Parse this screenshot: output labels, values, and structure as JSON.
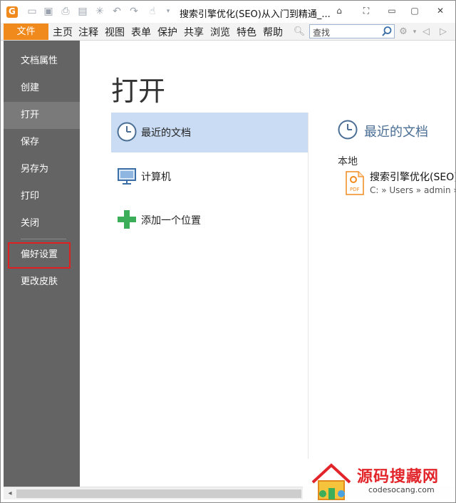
{
  "titlebar": {
    "document_title": "搜索引擎优化(SEO)从入门到精通_..."
  },
  "menubar": {
    "file_tab": "文件",
    "items": [
      "主页",
      "注释",
      "视图",
      "表单",
      "保护",
      "共享",
      "浏览",
      "特色",
      "帮助"
    ],
    "search_placeholder": "查找"
  },
  "leftnav": {
    "items": [
      {
        "label": "文档属性"
      },
      {
        "label": "创建"
      },
      {
        "label": "打开"
      },
      {
        "label": "保存"
      },
      {
        "label": "另存为"
      },
      {
        "label": "打印"
      },
      {
        "label": "关闭"
      },
      {
        "label": "偏好设置"
      },
      {
        "label": "更改皮肤"
      }
    ],
    "active_item": "打开",
    "highlighted_item": "偏好设置"
  },
  "main": {
    "title": "打开",
    "options": [
      {
        "label": "最近的文档",
        "icon": "clock-icon"
      },
      {
        "label": "计算机",
        "icon": "computer-icon"
      },
      {
        "label": "添加一个位置",
        "icon": "plus-icon"
      }
    ],
    "recent": {
      "title": "最近的文档",
      "section_label": "本地",
      "files": [
        {
          "name": "搜索引擎优化(SEO)",
          "path": "C: » Users » admin »",
          "type_badge": "PDF"
        }
      ]
    }
  },
  "watermark": {
    "title": "源码搜藏网",
    "url": "codesocang.com"
  },
  "colors": {
    "accent_orange": "#f08a1c",
    "nav_bg": "#646464",
    "selected_bg": "#c9dcf3",
    "recent_title": "#4a6e94",
    "highlight_red": "#e02020"
  }
}
